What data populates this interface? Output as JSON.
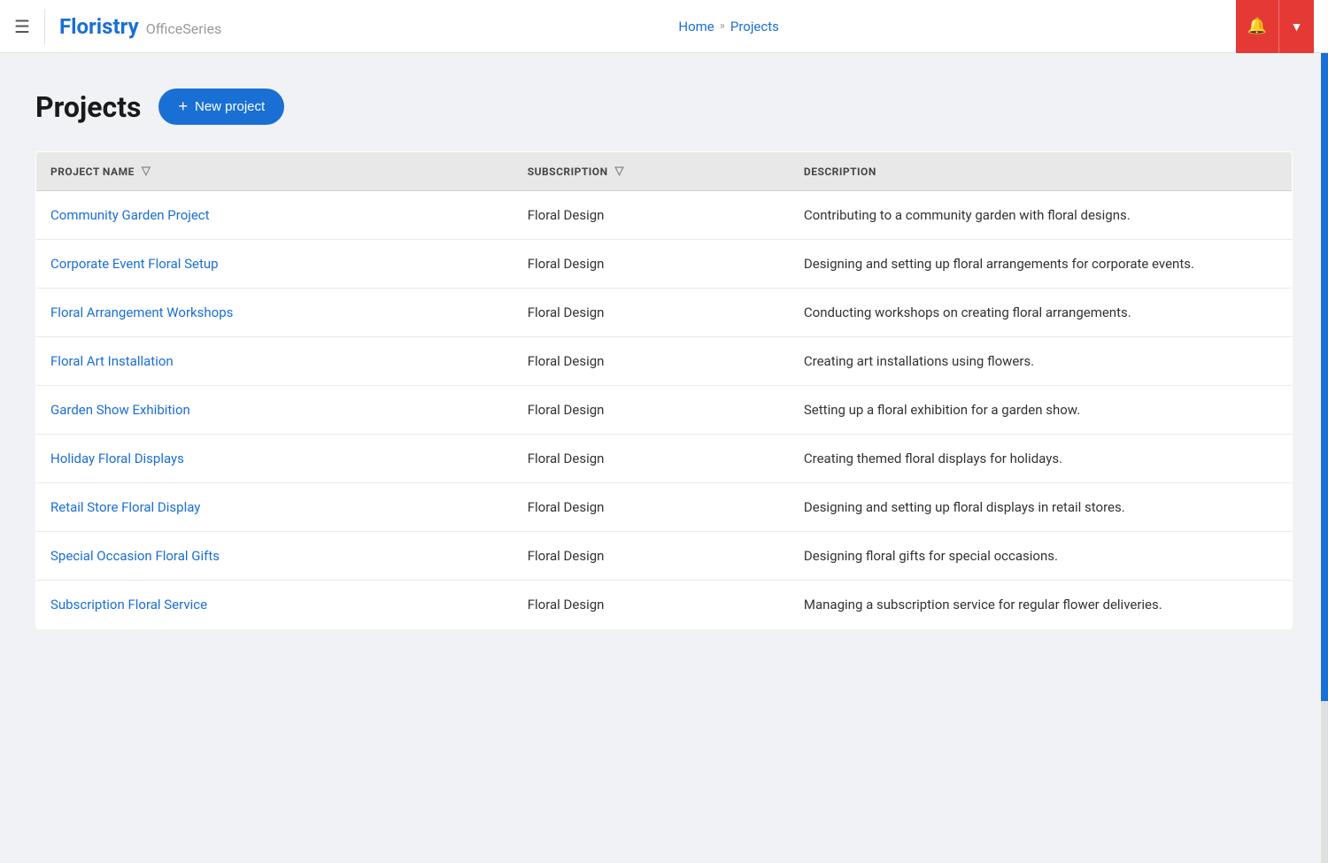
{
  "header": {
    "menu_label": "☰",
    "brand": "Floristry",
    "series": "OfficeSeries",
    "breadcrumb": {
      "home": "Home",
      "separator": "»",
      "current": "Projects"
    },
    "bell_icon": "🔔",
    "dropdown_icon": "▼"
  },
  "page": {
    "title": "Projects",
    "new_project_button": "New project",
    "new_project_plus": "+"
  },
  "table": {
    "columns": [
      {
        "id": "project_name",
        "label": "PROJECT NAME",
        "has_filter": true
      },
      {
        "id": "subscription",
        "label": "SUBSCRIPTION",
        "has_filter": true
      },
      {
        "id": "description",
        "label": "DESCRIPTION",
        "has_filter": false
      }
    ],
    "rows": [
      {
        "project_name": "Community Garden Project",
        "subscription": "Floral Design",
        "description": "Contributing to a community garden with floral designs."
      },
      {
        "project_name": "Corporate Event Floral Setup",
        "subscription": "Floral Design",
        "description": "Designing and setting up floral arrangements for corporate events."
      },
      {
        "project_name": "Floral Arrangement Workshops",
        "subscription": "Floral Design",
        "description": "Conducting workshops on creating floral arrangements."
      },
      {
        "project_name": "Floral Art Installation",
        "subscription": "Floral Design",
        "description": "Creating art installations using flowers."
      },
      {
        "project_name": "Garden Show Exhibition",
        "subscription": "Floral Design",
        "description": "Setting up a floral exhibition for a garden show."
      },
      {
        "project_name": "Holiday Floral Displays",
        "subscription": "Floral Design",
        "description": "Creating themed floral displays for holidays."
      },
      {
        "project_name": "Retail Store Floral Display",
        "subscription": "Floral Design",
        "description": "Designing and setting up floral displays in retail stores."
      },
      {
        "project_name": "Special Occasion Floral Gifts",
        "subscription": "Floral Design",
        "description": "Designing floral gifts for special occasions."
      },
      {
        "project_name": "Subscription Floral Service",
        "subscription": "Floral Design",
        "description": "Managing a subscription service for regular flower deliveries."
      }
    ]
  }
}
